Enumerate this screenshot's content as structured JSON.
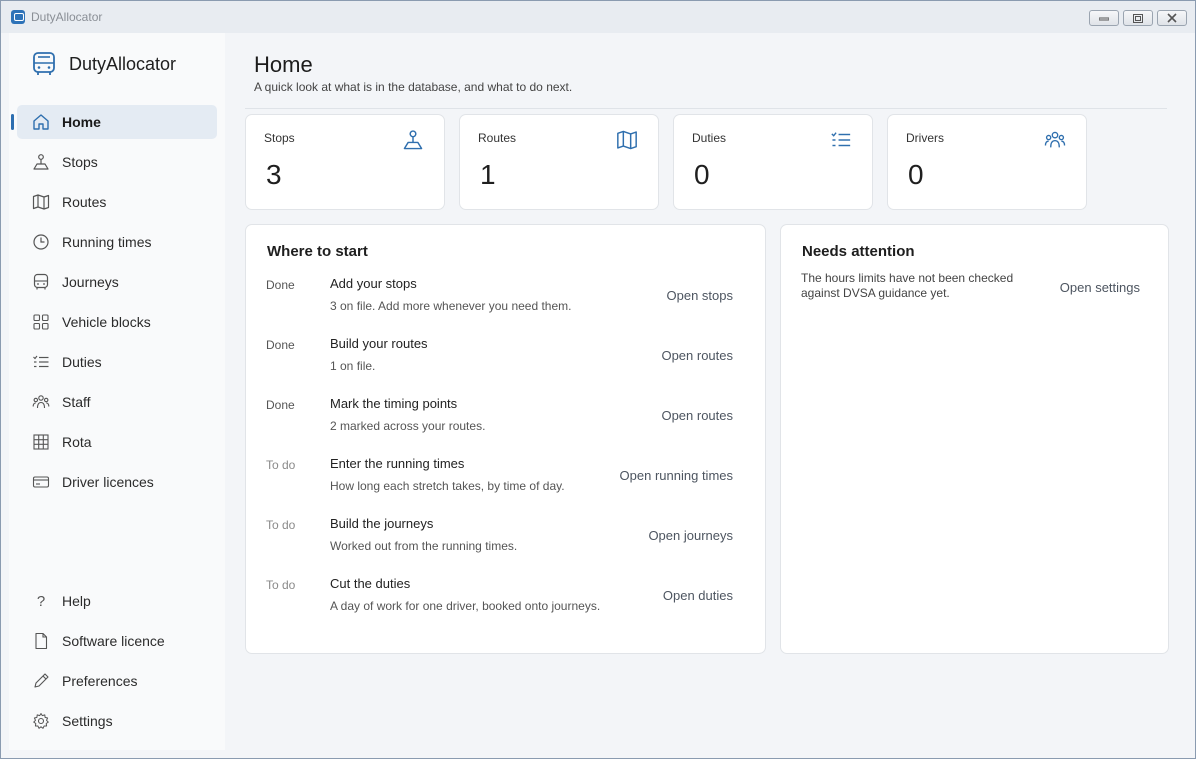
{
  "window": {
    "title": "DutyAllocator",
    "controls": [
      "minimize",
      "restore",
      "close"
    ]
  },
  "sidebar": {
    "brand": "DutyAllocator",
    "items": [
      {
        "label": "Home",
        "icon": "home-icon",
        "active": true
      },
      {
        "label": "Stops",
        "icon": "stop-pin-icon"
      },
      {
        "label": "Routes",
        "icon": "map-icon"
      },
      {
        "label": "Running times",
        "icon": "clock-icon"
      },
      {
        "label": "Journeys",
        "icon": "bus-icon"
      },
      {
        "label": "Vehicle blocks",
        "icon": "grid-icon"
      },
      {
        "label": "Duties",
        "icon": "checklist-icon"
      },
      {
        "label": "Staff",
        "icon": "people-icon"
      },
      {
        "label": "Rota",
        "icon": "table-icon"
      },
      {
        "label": "Driver licences",
        "icon": "card-icon"
      }
    ],
    "bottom_items": [
      {
        "label": "Help",
        "icon": "question-icon"
      },
      {
        "label": "Software licence",
        "icon": "document-icon"
      },
      {
        "label": "Preferences",
        "icon": "pen-icon"
      },
      {
        "label": "Settings",
        "icon": "gear-icon"
      }
    ]
  },
  "main": {
    "title": "Home",
    "subtitle": "A quick look at what is in the database, and what to do next.",
    "stats": [
      {
        "label": "Stops",
        "value": "3",
        "icon": "stop-pin-icon"
      },
      {
        "label": "Routes",
        "value": "1",
        "icon": "map-icon"
      },
      {
        "label": "Duties",
        "value": "0",
        "icon": "checklist-icon"
      },
      {
        "label": "Drivers",
        "value": "0",
        "icon": "people-icon"
      }
    ],
    "start": {
      "title": "Where to start",
      "steps": [
        {
          "status": "Done",
          "title": "Add your stops",
          "desc": "3 on file. Add more whenever you need them.",
          "link": "Open stops"
        },
        {
          "status": "Done",
          "title": "Build your routes",
          "desc": "1 on file.",
          "link": "Open routes"
        },
        {
          "status": "Done",
          "title": "Mark the timing points",
          "desc": "2 marked across your routes.",
          "link": "Open routes"
        },
        {
          "status": "To do",
          "title": "Enter the running times",
          "desc": "How long each stretch takes, by time of day.",
          "link": "Open running times"
        },
        {
          "status": "To do",
          "title": "Build the journeys",
          "desc": "Worked out from the running times.",
          "link": "Open journeys"
        },
        {
          "status": "To do",
          "title": "Cut the duties",
          "desc": "A day of work for one driver, booked onto journeys.",
          "link": "Open duties"
        }
      ]
    },
    "attention": {
      "title": "Needs attention",
      "text": "The hours limits have not been checked against DVSA guidance yet.",
      "link": "Open settings"
    }
  },
  "colors": {
    "accent": "#2d6eb0",
    "icon_blue": "#2f6fae",
    "active_bg": "#e4ebf3",
    "card_bg": "#ffffff",
    "page_bg": "#f3f5f8"
  }
}
